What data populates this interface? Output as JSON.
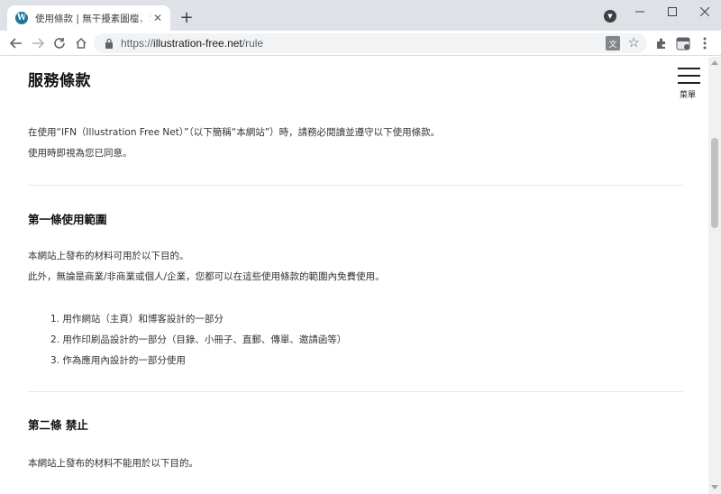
{
  "browser": {
    "tab_title": "使用條款 | 無干擾素圖檔，SVG",
    "tab_favicon_letter": "W",
    "new_tab_symbol": "+",
    "close_symbol": "✕",
    "url_scheme": "https://",
    "url_host": "illustration-free.net",
    "url_path": "/rule"
  },
  "page": {
    "title": "服務條款",
    "menu_label": "菜單",
    "intro": [
      "在使用“IFN（Illustration Free Net）”（以下簡稱“本網站”）時，請務必閱讀並遵守以下使用條款。",
      "使用時即視為您已同意。"
    ],
    "section1": {
      "heading": "第一條使用範圍",
      "paragraphs": [
        "本網站上發布的材料可用於以下目的。",
        "此外，無論是商業/非商業或個人/企業，您都可以在這些使用條款的範圍內免費使用。"
      ],
      "items": [
        "1. 用作網站（主頁）和博客設計的一部分",
        "2. 用作印刷品設計的一部分（目錄、小冊子、直郵、傳單、邀請函等）",
        "3. 作為應用內設計的一部分使用"
      ]
    },
    "section2": {
      "heading": "第二條 禁止",
      "paragraphs": [
        "本網站上發布的材料不能用於以下目的。"
      ]
    }
  }
}
